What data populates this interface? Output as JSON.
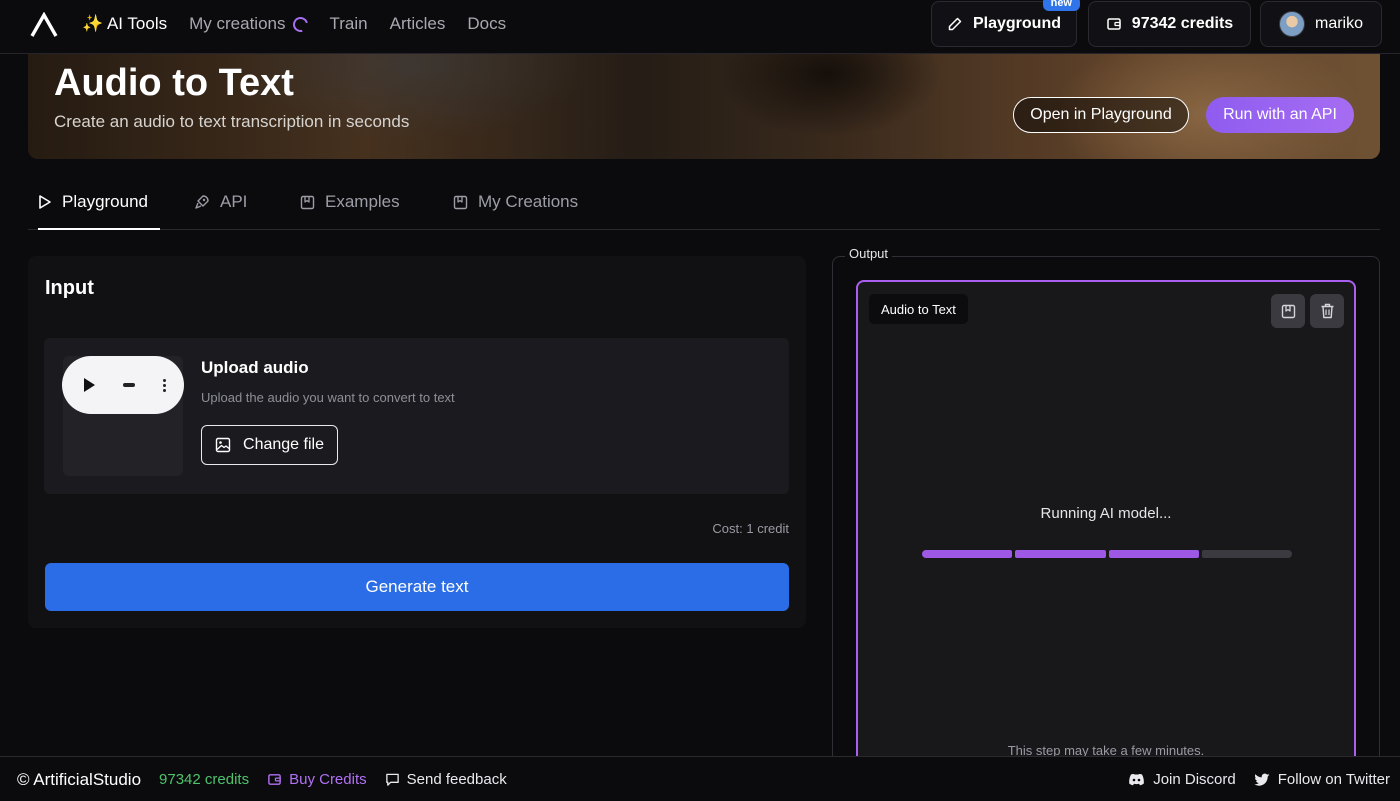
{
  "nav": {
    "ai_tools": "✨ AI Tools",
    "my_creations": "My creations",
    "train": "Train",
    "articles": "Articles",
    "docs": "Docs",
    "playground": "Playground",
    "new_badge": "new",
    "credits": "97342 credits",
    "username": "mariko"
  },
  "hero": {
    "title": "Audio to Text",
    "subtitle": "Create an audio to text transcription in seconds",
    "open_playground": "Open in Playground",
    "run_api": "Run with an API"
  },
  "tabs": [
    {
      "label": "Playground",
      "icon": "play-icon"
    },
    {
      "label": "API",
      "icon": "rocket-icon"
    },
    {
      "label": "Examples",
      "icon": "bookmark-icon"
    },
    {
      "label": "My Creations",
      "icon": "bookmark-icon"
    }
  ],
  "input": {
    "title": "Input",
    "upload_title": "Upload audio",
    "upload_sub": "Upload the audio you want to convert to text",
    "change_file": "Change file",
    "cost": "Cost: 1 credit",
    "generate": "Generate text"
  },
  "output": {
    "legend": "Output",
    "chip": "Audio to Text",
    "running": "Running AI model...",
    "progress_segments_done": 3,
    "progress_segments_total": 4,
    "note": "This step may take a few minutes."
  },
  "footer": {
    "brand": "© ArtificialStudio",
    "credits": "97342 credits",
    "buy": "Buy Credits",
    "feedback": "Send feedback",
    "discord": "Join Discord",
    "twitter": "Follow on Twitter"
  },
  "colors": {
    "accent_purple": "#a95ff0",
    "primary_blue": "#2b6de6",
    "credits_green": "#4fc26a"
  }
}
